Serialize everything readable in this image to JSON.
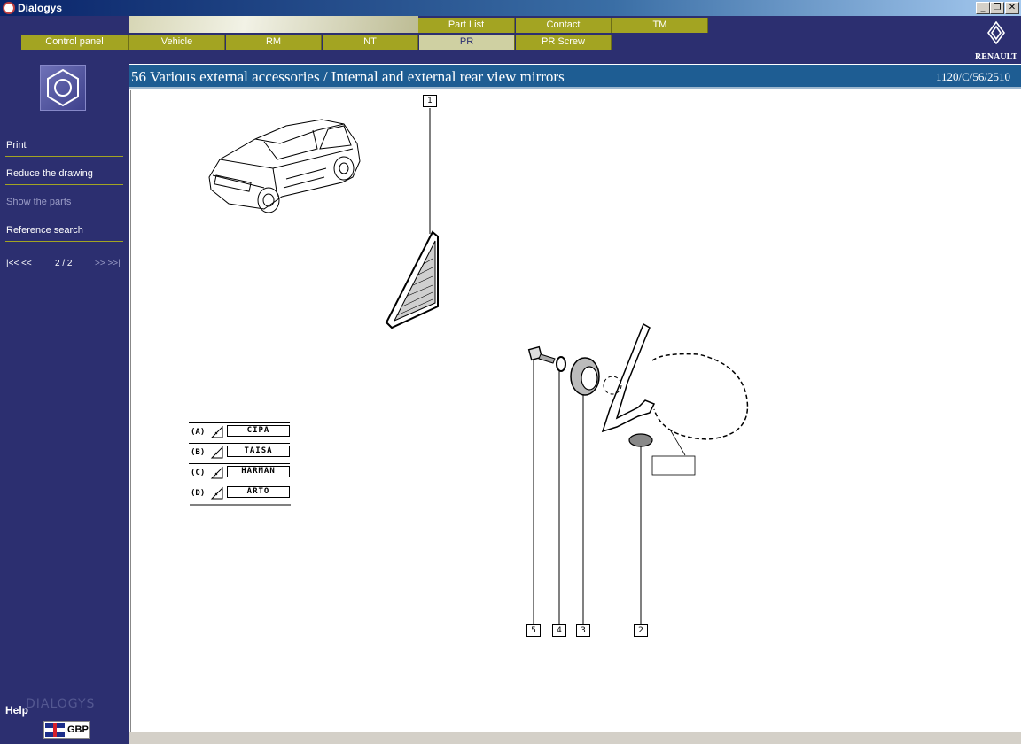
{
  "window": {
    "title": "Dialogys"
  },
  "tabs_top": [
    {
      "label": "Part List"
    },
    {
      "label": "Contact"
    },
    {
      "label": "TM"
    }
  ],
  "tabs_bottom": [
    {
      "label": "Control panel"
    },
    {
      "label": "Vehicle"
    },
    {
      "label": "RM"
    },
    {
      "label": "NT"
    },
    {
      "label": "PR",
      "active": true
    },
    {
      "label": "PR Screw"
    }
  ],
  "brand": {
    "name": "RENAULT"
  },
  "sidebar": {
    "items": [
      {
        "label": "Print",
        "enabled": true
      },
      {
        "label": "Reduce the drawing",
        "enabled": true
      },
      {
        "label": "Show the parts",
        "enabled": false
      },
      {
        "label": "Reference search",
        "enabled": true
      }
    ],
    "pager": {
      "first_prev": "|<< <<",
      "pages": "2 / 2",
      "next_last": ">> >>|"
    },
    "help_label": "Help",
    "product_mark": "DIALOGYS",
    "currency": "GBP"
  },
  "page": {
    "title": "56 Various external accessories / Internal and external rear view mirrors",
    "reference": "1120/C/56/2510"
  },
  "drawing": {
    "callouts": [
      "1",
      "2",
      "3",
      "4",
      "5"
    ],
    "variants": [
      {
        "code": "(A)",
        "name": "CIPA"
      },
      {
        "code": "(B)",
        "name": "TAISA"
      },
      {
        "code": "(C)",
        "name": "HARMAN"
      },
      {
        "code": "(D)",
        "name": "ARTO"
      }
    ]
  },
  "colors": {
    "navy": "#2c2f70",
    "tab_olive": "#a3a422",
    "tab_active": "#cfd0a2",
    "title_strip": "#1e5d93"
  }
}
